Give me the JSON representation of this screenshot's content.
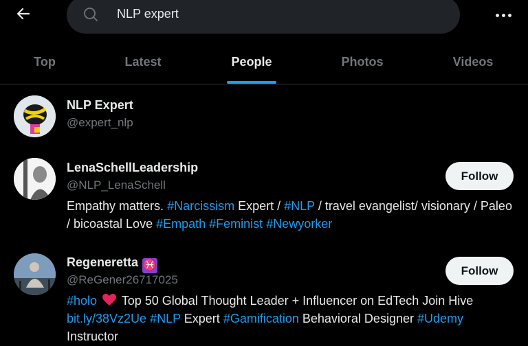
{
  "search": {
    "value": "NLP expert"
  },
  "tabs": [
    {
      "label": "Top"
    },
    {
      "label": "Latest"
    },
    {
      "label": "People"
    },
    {
      "label": "Photos"
    },
    {
      "label": "Videos"
    }
  ],
  "accent_color": "#1d9bf0",
  "results": [
    {
      "name": "NLP Expert",
      "handle": "@expert_nlp"
    },
    {
      "name": "LenaSchellLeadership",
      "handle": "@NLP_LenaSchell",
      "follow": "Follow",
      "bio": {
        "t1": "Empathy matters. ",
        "h1": "#Narcissism",
        "t2": " Expert / ",
        "h2": "#NLP",
        "t3": " / travel evangelist/ visionary / Paleo / bicoastal Love ",
        "h3": "#Empath",
        "t4": " ",
        "h4": "#Feminist",
        "t5": " ",
        "h5": "#Newyorker"
      }
    },
    {
      "name": "Regeneretta",
      "name_emoji": "♓",
      "handle": "@ReGener26717025",
      "follow": "Follow",
      "bio": {
        "h1": "#holo",
        "t1": " Top 50 Global Thought Leader + Influencer on EdTech Join Hive ",
        "h2": "bit.ly/38Vz2Ue",
        "t2": " ",
        "h3": "#NLP",
        "t3": " Expert ",
        "h4": "#Gamification",
        "t4": " Behavioral Designer ",
        "h5": "#Udemy",
        "t5": " Instructor"
      }
    }
  ]
}
